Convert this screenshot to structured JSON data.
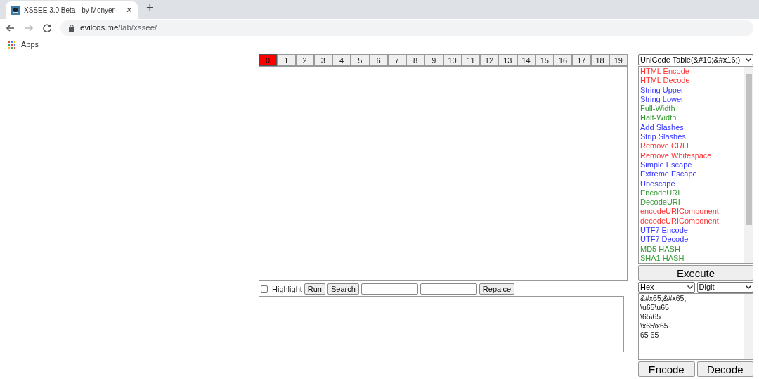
{
  "browser": {
    "tab_title": "XSSEE 3.0 Beta - by Monyer",
    "close_glyph": "×",
    "new_tab_glyph": "+",
    "url_host": "evilcos.me",
    "url_path": "/lab/xssee/",
    "bookmarks": [
      "Apps"
    ]
  },
  "slot_tabs": [
    {
      "label": "0",
      "selected": true
    },
    {
      "label": "1",
      "selected": false
    },
    {
      "label": "2",
      "selected": false
    },
    {
      "label": "3",
      "selected": false
    },
    {
      "label": "4",
      "selected": false
    },
    {
      "label": "5",
      "selected": false
    },
    {
      "label": "6",
      "selected": false
    },
    {
      "label": "7",
      "selected": false
    },
    {
      "label": "8",
      "selected": false
    },
    {
      "label": "9",
      "selected": false
    },
    {
      "label": "10",
      "selected": false
    },
    {
      "label": "11",
      "selected": false
    },
    {
      "label": "12",
      "selected": false
    },
    {
      "label": "13",
      "selected": false
    },
    {
      "label": "14",
      "selected": false
    },
    {
      "label": "15",
      "selected": false
    },
    {
      "label": "16",
      "selected": false
    },
    {
      "label": "17",
      "selected": false
    },
    {
      "label": "18",
      "selected": false
    },
    {
      "label": "19",
      "selected": false
    }
  ],
  "toolbar": {
    "highlight": {
      "label": "Highlight",
      "checked": false
    },
    "buttons": [
      "Run",
      "Search"
    ],
    "replace_button": "Repalce"
  },
  "table_select": "UniCode Table(&#10;&#x16;)",
  "functions": [
    {
      "label": "HTML Encode",
      "color": "#ff3333"
    },
    {
      "label": "HTML Decode",
      "color": "#ff3333"
    },
    {
      "label": "String Upper",
      "color": "#3333ff"
    },
    {
      "label": "String Lower",
      "color": "#3333ff"
    },
    {
      "label": "Full-Width",
      "color": "#339933"
    },
    {
      "label": "Half-Width",
      "color": "#339933"
    },
    {
      "label": "Add Slashes",
      "color": "#3333ff"
    },
    {
      "label": "Strip Slashes",
      "color": "#3333ff"
    },
    {
      "label": "Remove CRLF",
      "color": "#ff3333"
    },
    {
      "label": "Remove Whitespace",
      "color": "#ff3333"
    },
    {
      "label": "Simple Escape",
      "color": "#3333ff"
    },
    {
      "label": "Extreme Escape",
      "color": "#3333ff"
    },
    {
      "label": "Unescape",
      "color": "#3333ff"
    },
    {
      "label": "EncodeURI",
      "color": "#339933"
    },
    {
      "label": "DecodeURI",
      "color": "#339933"
    },
    {
      "label": "encodeURIComponent",
      "color": "#ff3333"
    },
    {
      "label": "decodeURIComponent",
      "color": "#ff3333"
    },
    {
      "label": "UTF7 Encode",
      "color": "#3333ff"
    },
    {
      "label": "UTF7 Decode",
      "color": "#3333ff"
    },
    {
      "label": "MD5 HASH",
      "color": "#339933"
    },
    {
      "label": "SHA1 HASH",
      "color": "#339933"
    }
  ],
  "execute_button": "Execute",
  "format_selects": [
    "Hex",
    "Digit"
  ],
  "output_lines": [
    "&#x65;&#x65;",
    "\\u65\\u65",
    "\\65\\65",
    "\\x65\\x65",
    "65 65"
  ],
  "action_buttons": [
    "Encode",
    "Decode"
  ]
}
